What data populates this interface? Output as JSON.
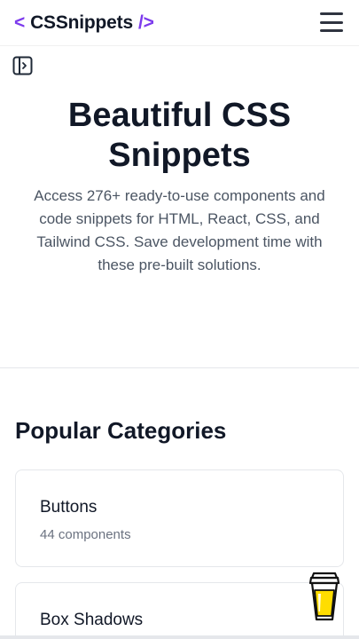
{
  "header": {
    "logo_open": "<",
    "logo_name": "CSSnippets",
    "logo_close": "/>",
    "menu_icon": "hamburger-menu-icon",
    "accent_color": "#7c3aed"
  },
  "sidebar_toggle_icon": "sidebar-panel-icon",
  "hero": {
    "title": "Beautiful CSS Snippets",
    "subtitle": "Access 276+ ready-to-use components and code snippets for HTML, React, CSS, and Tailwind CSS. Save development time with these pre-built solutions."
  },
  "categories": {
    "heading": "Popular Categories",
    "items": [
      {
        "title": "Buttons",
        "count": "44 components"
      },
      {
        "title": "Box Shadows"
      }
    ]
  },
  "floating_button_icon": "coffee-cup-icon"
}
